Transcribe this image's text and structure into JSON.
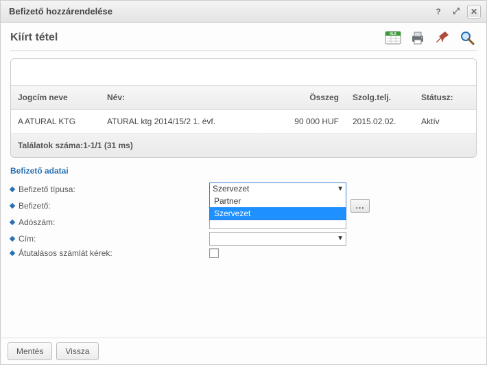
{
  "dialog": {
    "title": "Befizető hozzárendelése",
    "help_icon": "?",
    "expand_icon": "⤢",
    "close_icon": "✕"
  },
  "panel": {
    "title": "Kiírt tétel"
  },
  "toolbar": {
    "excel_label": "XLS",
    "print_label": "print",
    "pin_label": "pin",
    "search_label": "search"
  },
  "grid": {
    "headers": {
      "jogcim": "Jogcím neve",
      "nev": "Név:",
      "osszeg": "Összeg",
      "szolg": "Szolg.telj.",
      "statusz": "Státusz:"
    },
    "rows": [
      {
        "jogcim": "A ATURAL KTG",
        "nev": "ATURAL ktg 2014/15/2 1. évf.",
        "osszeg": "90 000 HUF",
        "szolg": "2015.02.02.",
        "statusz": "Aktív"
      }
    ],
    "footer": "Találatok száma:1-1/1 (31 ms)"
  },
  "section": {
    "title": "Befizető adatai"
  },
  "form": {
    "tipus": {
      "label": "Befizető típusa:",
      "value": "Szervezet",
      "options": [
        "Partner",
        "Szervezet"
      ]
    },
    "befizeto": {
      "label": "Befizető:",
      "dots": "..."
    },
    "adoszam": {
      "label": "Adószám:"
    },
    "cim": {
      "label": "Cím:",
      "value": ""
    },
    "atutalas": {
      "label": "Átutalásos számlát kérek:"
    }
  },
  "buttons": {
    "save": "Mentés",
    "back": "Vissza"
  }
}
